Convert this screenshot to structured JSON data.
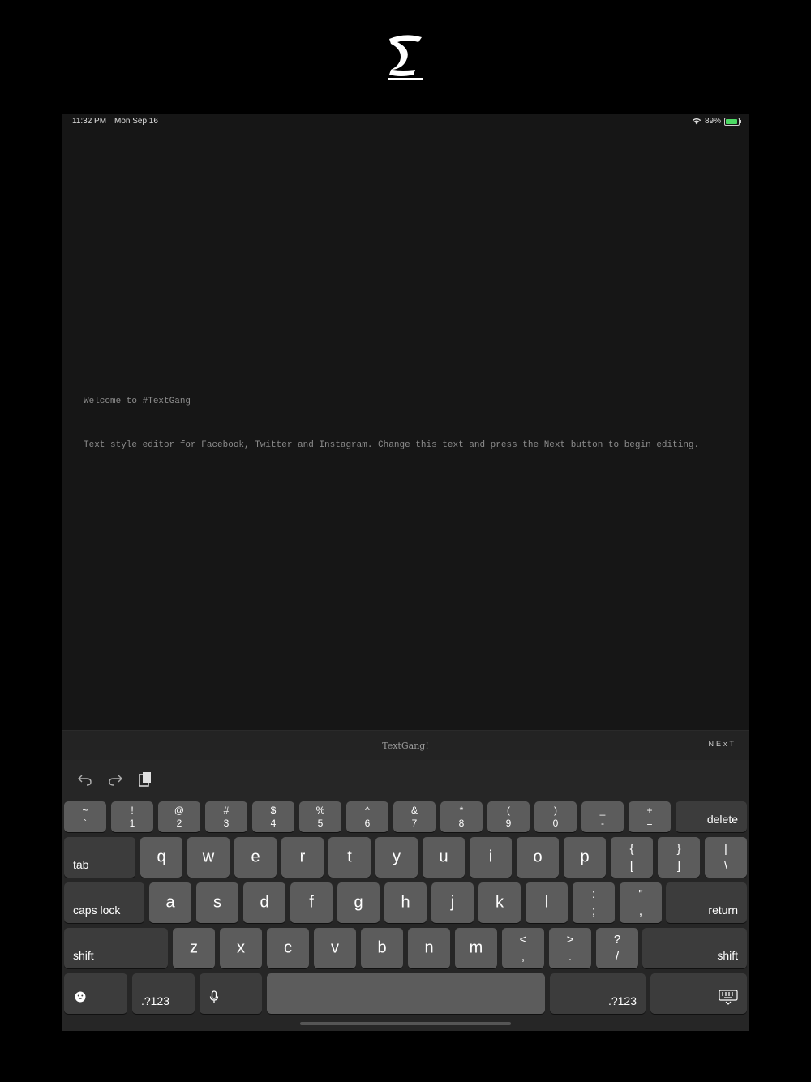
{
  "app": {
    "logo_glyph": "ᴛ"
  },
  "status": {
    "time": "11:32 PM",
    "date": "Mon Sep 16",
    "battery": "89%"
  },
  "editor": {
    "line1": "Welcome to #TextGang",
    "line2": "Text style editor for Facebook, Twitter and Instagram. Change this text and press the Next button to begin editing."
  },
  "toolbar": {
    "brand": "TextGang!",
    "next_label": "NExT"
  },
  "keyboard": {
    "row1": [
      {
        "top": "~",
        "bot": "`"
      },
      {
        "top": "!",
        "bot": "1"
      },
      {
        "top": "@",
        "bot": "2"
      },
      {
        "top": "#",
        "bot": "3"
      },
      {
        "top": "$",
        "bot": "4"
      },
      {
        "top": "%",
        "bot": "5"
      },
      {
        "top": "^",
        "bot": "6"
      },
      {
        "top": "&",
        "bot": "7"
      },
      {
        "top": "*",
        "bot": "8"
      },
      {
        "top": "(",
        "bot": "9"
      },
      {
        "top": ")",
        "bot": "0"
      },
      {
        "top": "_",
        "bot": "-"
      },
      {
        "top": "+",
        "bot": "="
      }
    ],
    "delete": "delete",
    "tab": "tab",
    "row2": [
      "q",
      "w",
      "e",
      "r",
      "t",
      "y",
      "u",
      "i",
      "o",
      "p"
    ],
    "row2_sym": [
      {
        "top": "{",
        "bot": "["
      },
      {
        "top": "}",
        "bot": "]"
      },
      {
        "top": "|",
        "bot": "\\"
      }
    ],
    "caps": "caps lock",
    "row3": [
      "a",
      "s",
      "d",
      "f",
      "g",
      "h",
      "j",
      "k",
      "l"
    ],
    "row3_sym": [
      {
        "top": ":",
        "bot": ";"
      },
      {
        "top": "\"",
        "bot": ","
      }
    ],
    "return": "return",
    "shift_left": "shift",
    "row4": [
      "z",
      "x",
      "c",
      "v",
      "b",
      "n",
      "m"
    ],
    "row4_sym": [
      {
        "top": "<",
        "bot": ","
      },
      {
        "top": ">",
        "bot": "."
      },
      {
        "top": "?",
        "bot": "/"
      }
    ],
    "shift_right": "shift",
    "num_left": ".?123",
    "num_right": ".?123"
  }
}
